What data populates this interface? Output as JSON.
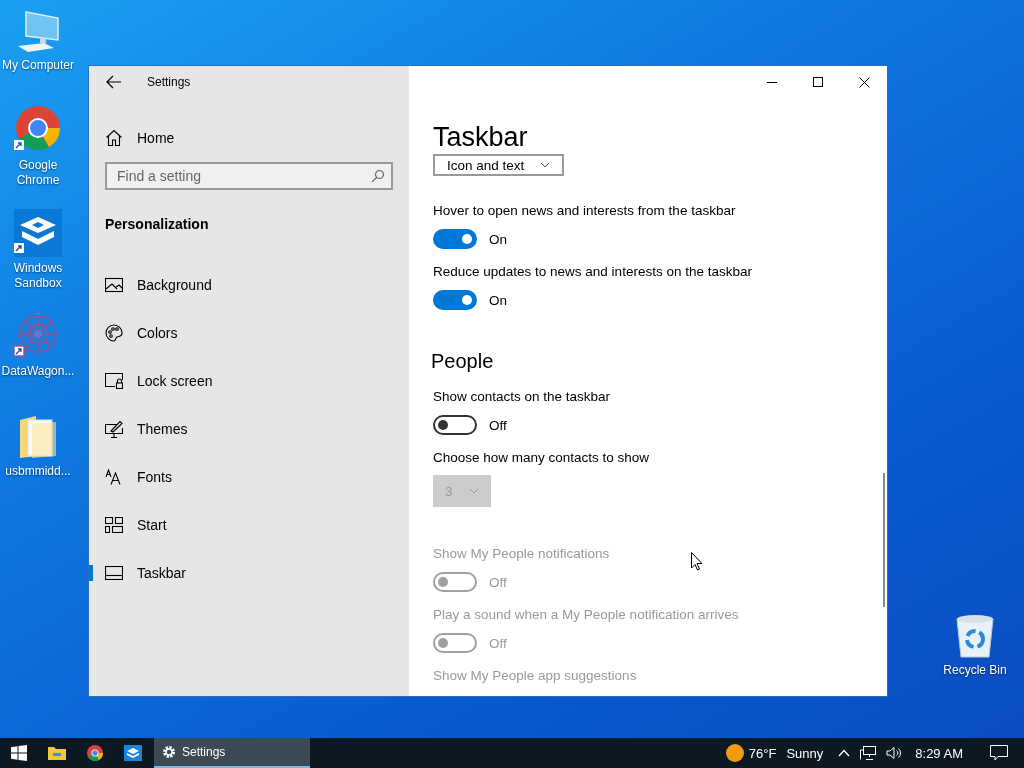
{
  "desktop_icons": [
    {
      "label": "My Computer"
    },
    {
      "label": "Google Chrome"
    },
    {
      "label": "Windows Sandbox"
    },
    {
      "label": "DataWagon..."
    },
    {
      "label": "usbmmidd..."
    },
    {
      "label": "Recycle Bin"
    }
  ],
  "window": {
    "title": "Settings",
    "sidebar": {
      "home": "Home",
      "search": {
        "placeholder": "Find a setting"
      },
      "section": "Personalization",
      "items": [
        {
          "label": "Background",
          "selected": false
        },
        {
          "label": "Colors",
          "selected": false
        },
        {
          "label": "Lock screen",
          "selected": false
        },
        {
          "label": "Themes",
          "selected": false
        },
        {
          "label": "Fonts",
          "selected": false
        },
        {
          "label": "Start",
          "selected": false
        },
        {
          "label": "Taskbar",
          "selected": true
        }
      ]
    },
    "page": {
      "title": "Taskbar",
      "settings": [
        {
          "kind": "dropdown",
          "value": "Icon and text",
          "disabled": false
        },
        {
          "kind": "toggle",
          "label": "Hover to open news and interests from the taskbar",
          "on": true,
          "state": "On",
          "disabled": false
        },
        {
          "kind": "toggle",
          "label": "Reduce updates to news and interests on the taskbar",
          "on": true,
          "state": "On",
          "disabled": false
        },
        {
          "kind": "heading",
          "label": "People"
        },
        {
          "kind": "toggle",
          "label": "Show contacts on the taskbar",
          "on": false,
          "state": "Off",
          "disabled": false
        },
        {
          "kind": "dropdown",
          "label": "Choose how many contacts to show",
          "value": "3",
          "disabled": true
        },
        {
          "kind": "toggle",
          "label": "Show My People notifications",
          "on": false,
          "state": "Off",
          "disabled": true
        },
        {
          "kind": "toggle",
          "label": "Play a sound when a My People notification arrives",
          "on": false,
          "state": "Off",
          "disabled": true
        },
        {
          "kind": "label",
          "label": "Show My People app suggestions",
          "disabled": true
        }
      ]
    }
  },
  "taskbar": {
    "apps": [
      {
        "label": "Settings",
        "selected": true
      }
    ],
    "weather": {
      "temperature": "76°F",
      "condition": "Sunny"
    },
    "clock": "8:29 AM"
  }
}
